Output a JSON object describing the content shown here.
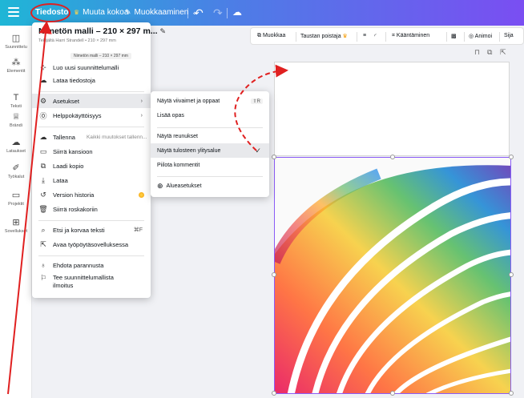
{
  "topbar": {
    "file_label": "Tiedosto",
    "resize_label": "Muuta kokoa",
    "edit_label": "Muokkaaminen"
  },
  "sidebar": {
    "items": [
      {
        "label": "Suunnittelu",
        "icon": "layout-icon"
      },
      {
        "label": "Elementit",
        "icon": "elements-icon"
      },
      {
        "label": "Teksti",
        "icon": "text-icon"
      },
      {
        "label": "Brändi",
        "icon": "brand-icon"
      },
      {
        "label": "Lataukset",
        "icon": "upload-icon"
      },
      {
        "label": "Työkalut",
        "icon": "tools-icon"
      },
      {
        "label": "Projektit",
        "icon": "folder-icon"
      },
      {
        "label": "Sovellukset",
        "icon": "apps-icon"
      }
    ]
  },
  "toolbar2": {
    "edit": "Muokkaa",
    "bg_remover": "Taustan poistaja",
    "flip": "Kääntäminen",
    "animate": "Animoi",
    "position": "Sija"
  },
  "file_menu": {
    "title": "Nimetön malli – 210 × 297 m...",
    "subtitle": "Tekijältä Harri Strandell • 210 × 297 mm",
    "tooltip": "Nimetön malli – 210 × 297 mm",
    "items": [
      {
        "label": "Luo uusi suunnittelumalli",
        "icon": "plus-icon"
      },
      {
        "label": "Lataa tiedostoja",
        "icon": "cloud-upload-icon"
      },
      {
        "label": "Asetukset",
        "icon": "gear-icon",
        "arrow": "›"
      },
      {
        "label": "Helppokäyttöisyys",
        "icon": "accessibility-icon",
        "arrow": "›"
      },
      {
        "label": "Tallenna",
        "icon": "cloud-save-icon",
        "hint": "Kaikki muutokset tallenn..."
      },
      {
        "label": "Siirrä kansioon",
        "icon": "folder-move-icon"
      },
      {
        "label": "Laadi kopio",
        "icon": "copy-icon"
      },
      {
        "label": "Lataa",
        "icon": "download-icon"
      },
      {
        "label": "Version historia",
        "icon": "history-icon"
      },
      {
        "label": "Siirrä roskakoriin",
        "icon": "trash-icon"
      },
      {
        "label": "Etsi ja korvaa teksti",
        "icon": "search-icon",
        "shortcut": "⌘F"
      },
      {
        "label": "Avaa työpöytäsovelluksessa",
        "icon": "external-icon"
      },
      {
        "label": "Ehdota parannusta",
        "icon": "lightbulb-icon"
      },
      {
        "label": "Tee suunnittelumallista",
        "label2": "ilmoitus",
        "icon": "flag-icon"
      }
    ]
  },
  "submenu": {
    "items": [
      {
        "label": "Näytä viivaimet ja oppaat",
        "kbd": "⇧R"
      },
      {
        "label": "Lisää opas"
      },
      {
        "label": "Näytä reunukset"
      },
      {
        "label": "Näytä tulosteen ylitysalue",
        "checked": true
      },
      {
        "label": "Piilota kommentit"
      },
      {
        "label": "Alueasetukset",
        "icon": "globe-icon"
      }
    ]
  },
  "colors": {
    "topbar_start": "#1fb6d6",
    "topbar_end": "#7a4ef2",
    "annotation_red": "#e02020",
    "selection_purple": "#8b5cf6"
  }
}
